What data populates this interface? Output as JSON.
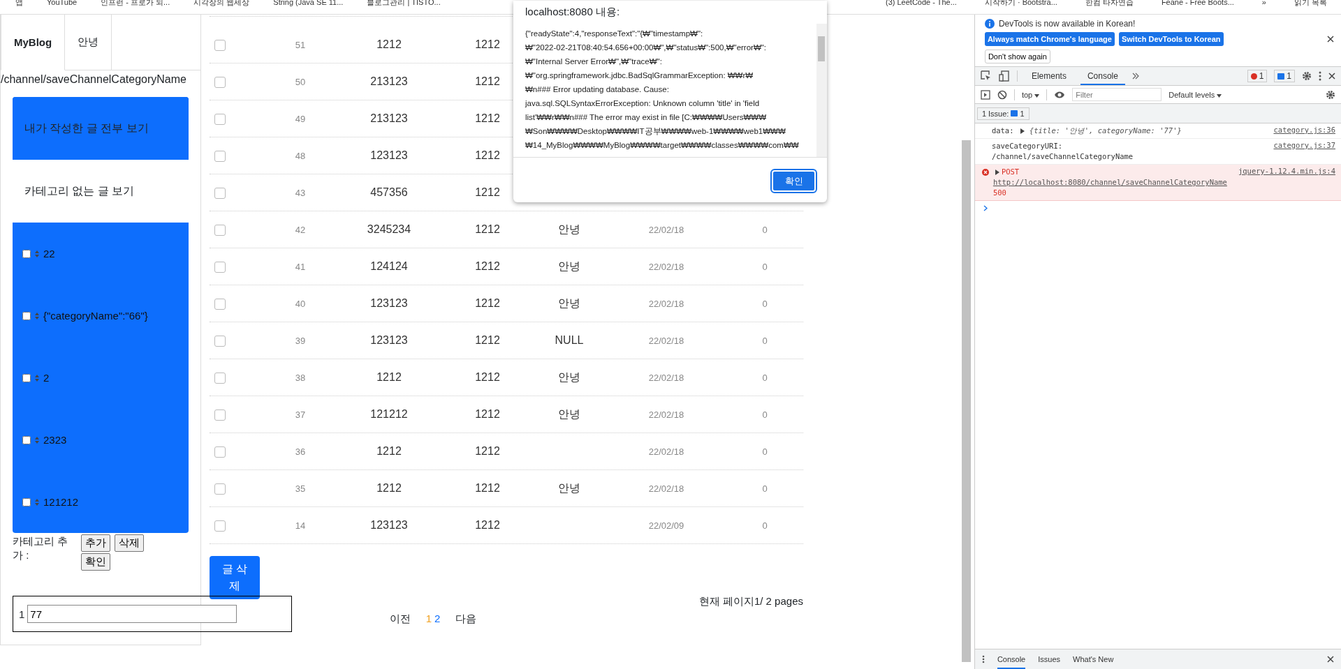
{
  "bookmarks_bar": {
    "left": [
      "앱",
      "YouTube",
      "인프런 - 프로가 되...",
      "시각장의 웹세상",
      "String (Java SE 11...",
      "블로그관리 | TISTO..."
    ],
    "right": [
      "(3) LeetCode - The...",
      "시작하기 · Bootstra...",
      "한컴 타자연습",
      "Feane - Free Boots..."
    ],
    "more": "»",
    "reading_list": "읽기 목록"
  },
  "tabs": [
    {
      "label": "MyBlog",
      "selected": true
    },
    {
      "label": "안녕",
      "selected": false
    }
  ],
  "path_text": "/channel/saveChannelCategoryName",
  "menu": [
    {
      "label": "내가 작성한 글 전부 보기",
      "selected": true
    },
    {
      "label": "카테고리 없는 글 보기",
      "selected": false
    }
  ],
  "categories": [
    {
      "name": "22",
      "checked": false
    },
    {
      "name": "{\"categoryName\":\"66\"}",
      "checked": false
    },
    {
      "name": "2",
      "checked": false
    },
    {
      "name": "2323",
      "checked": false
    },
    {
      "name": "121212",
      "checked": false
    }
  ],
  "category_add": {
    "label": "카테고리 추가 :",
    "buttons": [
      "추가",
      "삭제",
      "확인"
    ]
  },
  "new_category": {
    "index": "1",
    "value": "77"
  },
  "posts": [
    {
      "checked": false,
      "cells": [
        "51",
        "1212",
        "1212"
      ]
    },
    {
      "checked": false,
      "cells": [
        "50",
        "213123",
        "1212"
      ]
    },
    {
      "checked": false,
      "cells": [
        "49",
        "213123",
        "1212"
      ]
    },
    {
      "checked": false,
      "cells": [
        "48",
        "123123",
        "1212"
      ]
    },
    {
      "checked": false,
      "cells": [
        "43",
        "457356",
        "1212"
      ]
    },
    {
      "checked": false,
      "cells": [
        "42",
        "3245234",
        "1212",
        "안녕",
        "22/02/18",
        "0"
      ]
    },
    {
      "checked": false,
      "cells": [
        "41",
        "124124",
        "1212",
        "안녕",
        "22/02/18",
        "0"
      ]
    },
    {
      "checked": false,
      "cells": [
        "40",
        "123123",
        "1212",
        "안녕",
        "22/02/18",
        "0"
      ]
    },
    {
      "checked": false,
      "cells": [
        "39",
        "123123",
        "1212",
        "NULL",
        "22/02/18",
        "0"
      ]
    },
    {
      "checked": false,
      "cells": [
        "38",
        "1212",
        "1212",
        "안녕",
        "22/02/18",
        "0"
      ]
    },
    {
      "checked": false,
      "cells": [
        "37",
        "121212",
        "1212",
        "안녕",
        "22/02/18",
        "0"
      ]
    },
    {
      "checked": false,
      "cells": [
        "36",
        "1212",
        "1212",
        "",
        "22/02/18",
        "0"
      ]
    },
    {
      "checked": false,
      "cells": [
        "35",
        "1212",
        "1212",
        "안녕",
        "22/02/18",
        "0"
      ]
    },
    {
      "checked": false,
      "cells": [
        "14",
        "123123",
        "1212",
        "",
        "22/02/09",
        "0"
      ]
    }
  ],
  "delete_button": "글 삭제",
  "page_info": "현재 페이지1/ 2 pages",
  "pagination": {
    "prev": "이전",
    "pages": [
      {
        "label": "1",
        "selected": true
      },
      {
        "label": "2",
        "selected": false
      }
    ],
    "next": "다음"
  },
  "alert": {
    "title": "localhost:8080 내용:",
    "lines": [
      "{\"readyState\":4,\"responseText\":\"{₩\"timestamp₩\":",
      "₩\"2022-02-21T08:40:54.656+00:00₩\",₩\"status₩\":500,₩\"error₩\":",
      "₩\"Internal Server Error₩\",₩\"trace₩\":",
      "₩\"org.springframework.jdbc.BadSqlGrammarException: ₩₩r₩",
      "₩n### Error updating database.  Cause:",
      "java.sql.SQLSyntaxErrorException: Unknown column 'title' in 'field",
      "list'₩₩r₩₩n### The error may exist in file [C:₩₩₩₩Users₩₩₩",
      "₩Son₩₩₩₩Desktop₩₩₩₩IT공부₩₩₩₩web-1₩₩₩₩web1₩₩₩",
      "₩14_MyBlog₩₩₩₩MyBlog₩₩₩₩target₩₩₩₩classes₩₩₩₩com₩₩"
    ],
    "ok_button": "확인"
  },
  "devtools": {
    "notice": "DevTools is now available in Korean!",
    "notice_buttons": [
      "Always match Chrome's language",
      "Switch DevTools to Korean"
    ],
    "dismiss": "Don't show again",
    "tabs": [
      {
        "label": "Elements",
        "selected": false
      },
      {
        "label": "Console",
        "selected": true
      }
    ],
    "error_count": "1",
    "message_count": "1",
    "context": "top",
    "filter_placeholder": "Filter",
    "levels": "Default levels",
    "issues_label": "1 Issue:",
    "issues_count": "1",
    "messages": [
      {
        "kind": "log",
        "parts": [
          "data: ",
          "{title: '안녕', categoryName: '77'}"
        ],
        "source": "category.js:36"
      },
      {
        "kind": "text",
        "parts": [
          "saveCategoryURI:",
          "/channel/saveChannelCategoryName"
        ],
        "source": "category.js:37"
      },
      {
        "kind": "error",
        "parts": [
          "POST",
          "http://localhost:8080/channel/saveChannelCategoryName",
          "500"
        ],
        "source": "jquery-1.12.4.min.js:4"
      }
    ],
    "drawer_tabs": [
      {
        "label": "Console",
        "selected": true
      },
      {
        "label": "Issues",
        "selected": false
      },
      {
        "label": "What's New",
        "selected": false
      }
    ]
  }
}
